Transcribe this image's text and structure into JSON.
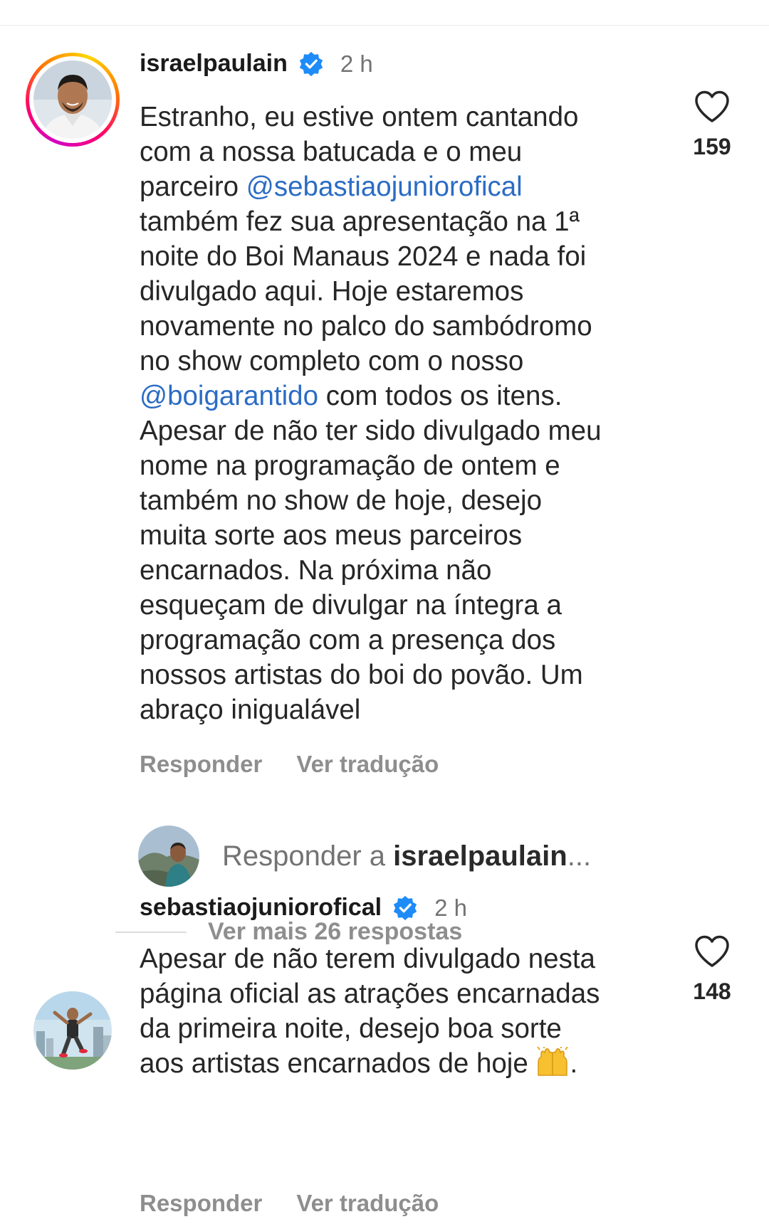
{
  "comments": [
    {
      "username": "israelpaulain",
      "time": "2 h",
      "text_before_mention1": "Estranho, eu estive ontem cantando\ncom a nossa batucada e o meu\nparceiro ",
      "mention1": "@sebastiaojuniorofical",
      "text_after_mention1": "\ntambém fez sua apresentação na 1ª\nnoite do Boi Manaus 2024 e nada foi\ndivulgado aqui. Hoje estaremos\nnovamente no palco do sambódromo\nno show completo com o nosso\n",
      "mention2": "@boigarantido",
      "text_after_mention2": " com todos os itens.\nApesar de não ter sido divulgado meu\nnome na programação de ontem e\ntambém no show de hoje, desejo\nmuita sorte aos meus parceiros\nencarnados. Na próxima não\nesqueçam de divulgar na íntegra a\nprogramação com a presença dos\nnossos artistas do boi do povão. Um\nabraço inigualável",
      "likes": "159",
      "reply_label": "Responder",
      "translate_label": "Ver tradução"
    },
    {
      "username": "sebastiaojuniorofical",
      "time": "2 h",
      "text": "Apesar de não terem divulgado nesta\npágina oficial as atrações encarnadas\nda primeira noite, desejo boa sorte\naos artistas encarnados de hoje ",
      "text_end": ".",
      "emoji": "raising-hands",
      "likes": "148",
      "reply_label": "Responder",
      "translate_label": "Ver tradução"
    }
  ],
  "reply_input": {
    "prefix": "Responder a ",
    "target": "israelpaulain",
    "ellipsis": "..."
  },
  "more_replies": "Ver mais 26 respostas",
  "colors": {
    "mention": "#2b6cc4",
    "verified": "#1d8cf8",
    "secondary_text": "#737373"
  }
}
